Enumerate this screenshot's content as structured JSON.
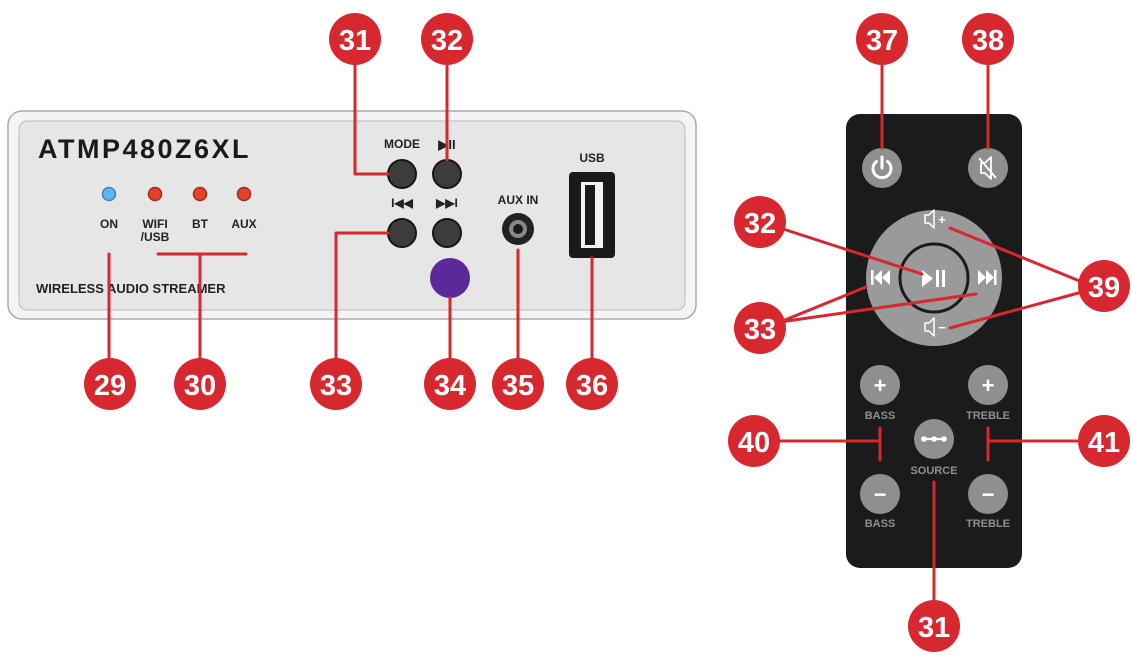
{
  "panel": {
    "model": "ATMP480Z6XL",
    "subtitle": "WIRELESS AUDIO STREAMER",
    "led_labels": [
      "ON",
      "WIFI",
      "/USB",
      "BT",
      "AUX"
    ],
    "mode_label": "MODE",
    "play_glyph": "▶II",
    "prev_glyph": "I◀◀",
    "next_glyph": "▶▶I",
    "aux_label": "AUX IN",
    "usb_label": "USB"
  },
  "remote": {
    "bass_label": "BASS",
    "treble_label": "TREBLE",
    "source_label": "SOURCE",
    "plus": "+",
    "minus": "−",
    "vol_up": "+",
    "vol_down": "−"
  },
  "callouts": {
    "c29": "29",
    "c30": "30",
    "c31": "31",
    "c32": "32",
    "c33": "33",
    "c34": "34",
    "c35": "35",
    "c36": "36",
    "c37": "37",
    "c38": "38",
    "c39": "39",
    "c40": "40",
    "c41": "41"
  },
  "colors": {
    "callout": "#d7282f",
    "led_blue": "#5ab7ef",
    "led_red": "#e2432b",
    "panel": "#e6e6e6",
    "remote": "#1b1b1b",
    "knob": "#3c3c3c",
    "ir_window": "#5b2a9a",
    "remote_button": "#8f8f8f"
  }
}
